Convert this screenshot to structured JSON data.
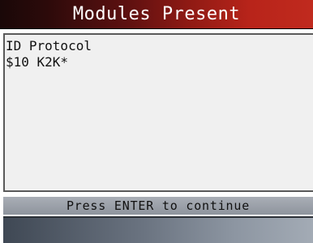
{
  "title": "Modules Present",
  "content": {
    "lines": [
      "ID Protocol",
      "$10 K2K*"
    ]
  },
  "status": {
    "prompt": "Press ENTER to continue"
  }
}
